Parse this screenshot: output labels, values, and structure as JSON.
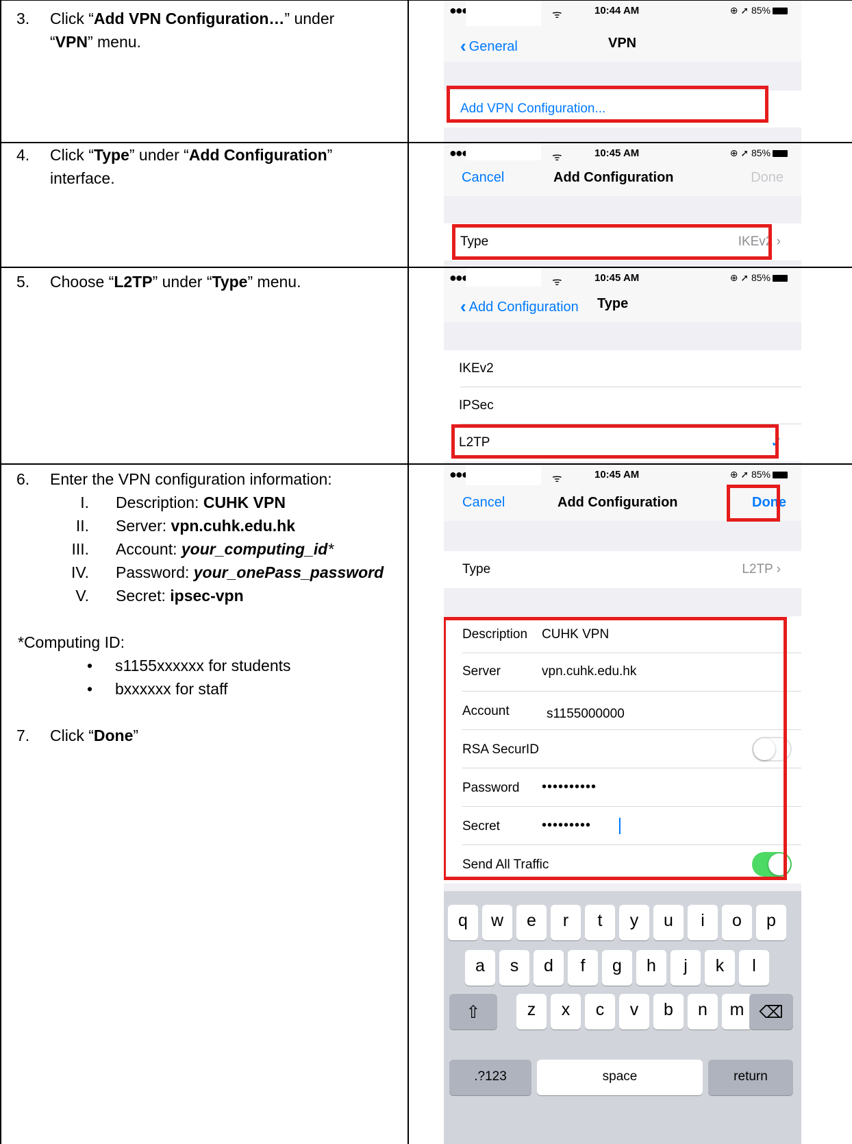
{
  "steps": {
    "s3": {
      "num": "3.",
      "pre": "Click “",
      "b1": "Add VPN Configuration…",
      "mid": "” under",
      "l2pre": "“",
      "b2": "VPN",
      "l2post": "” menu."
    },
    "s4": {
      "num": "4.",
      "pre": "Click “",
      "b1": "Type",
      "mid": "” under “",
      "b2": "Add Configuration",
      "post": "”",
      "line2": "interface."
    },
    "s5": {
      "num": "5.",
      "pre": "Choose “",
      "b1": "L2TP",
      "mid": "” under “",
      "b2": "Type",
      "post": "” menu."
    },
    "s6": {
      "num": "6.",
      "intro": "Enter the VPN configuration information:",
      "items": [
        {
          "roman": "I.",
          "label": "Description: ",
          "value": "CUHK VPN"
        },
        {
          "roman": "II.",
          "label": "Server: ",
          "value": "vpn.cuhk.edu.hk"
        },
        {
          "roman": "III.",
          "label": "Account: ",
          "value": "your_computing_id",
          "suffix": "*"
        },
        {
          "roman": "IV.",
          "label": "Password: ",
          "value": "your_onePass_password"
        },
        {
          "roman": "V.",
          "label": "Secret: ",
          "value": "ipsec-vpn"
        }
      ],
      "note": "*Computing ID:",
      "bullets": [
        "s1155xxxxxx for students",
        "bxxxxxx for staff"
      ]
    },
    "s7": {
      "num": "7.",
      "pre": "Click “",
      "b1": "Done",
      "post": "”"
    }
  },
  "screens": {
    "vpn": {
      "time": "10:44 AM",
      "status_right": "85%",
      "back": "General",
      "title": "VPN",
      "row": "Add VPN Configuration..."
    },
    "addconf1": {
      "time": "10:45 AM",
      "status_right": "85%",
      "cancel": "Cancel",
      "title": "Add Configuration",
      "done": "Done",
      "type_label": "Type",
      "type_value": "IKEv2"
    },
    "type": {
      "time": "10:45 AM",
      "status_right": "85%",
      "back": "Add Configuration",
      "title": "Type",
      "options": [
        "IKEv2",
        "IPSec",
        "L2TP"
      ]
    },
    "addconf2": {
      "time": "10:45 AM",
      "status_right": "85%",
      "cancel": "Cancel",
      "title": "Add Configuration",
      "done": "Done",
      "type_label": "Type",
      "type_value": "L2TP",
      "fields": {
        "description_label": "Description",
        "description_value": "CUHK VPN",
        "server_label": "Server",
        "server_value": "vpn.cuhk.edu.hk",
        "account_label": "Account",
        "account_value": "s1155000000",
        "rsa_label": "RSA SecurID",
        "password_label": "Password",
        "password_value": "••••••••••",
        "secret_label": "Secret",
        "secret_value": "•••••••••",
        "send_label": "Send All Traffic"
      },
      "toggles": {
        "rsa": false,
        "send_all_traffic": true
      },
      "keyboard": {
        "row1": [
          "q",
          "w",
          "e",
          "r",
          "t",
          "y",
          "u",
          "i",
          "o",
          "p"
        ],
        "row2": [
          "a",
          "s",
          "d",
          "f",
          "g",
          "h",
          "j",
          "k",
          "l"
        ],
        "row3": [
          "z",
          "x",
          "c",
          "v",
          "b",
          "n",
          "m"
        ],
        "shift": "⇧",
        "delete": "⌫",
        "numbers": ".?123",
        "space": "space",
        "return": "return"
      }
    }
  },
  "colors": {
    "ios_blue": "#007aff",
    "highlight_red": "#e51c1c",
    "toggle_green": "#4cd964"
  }
}
